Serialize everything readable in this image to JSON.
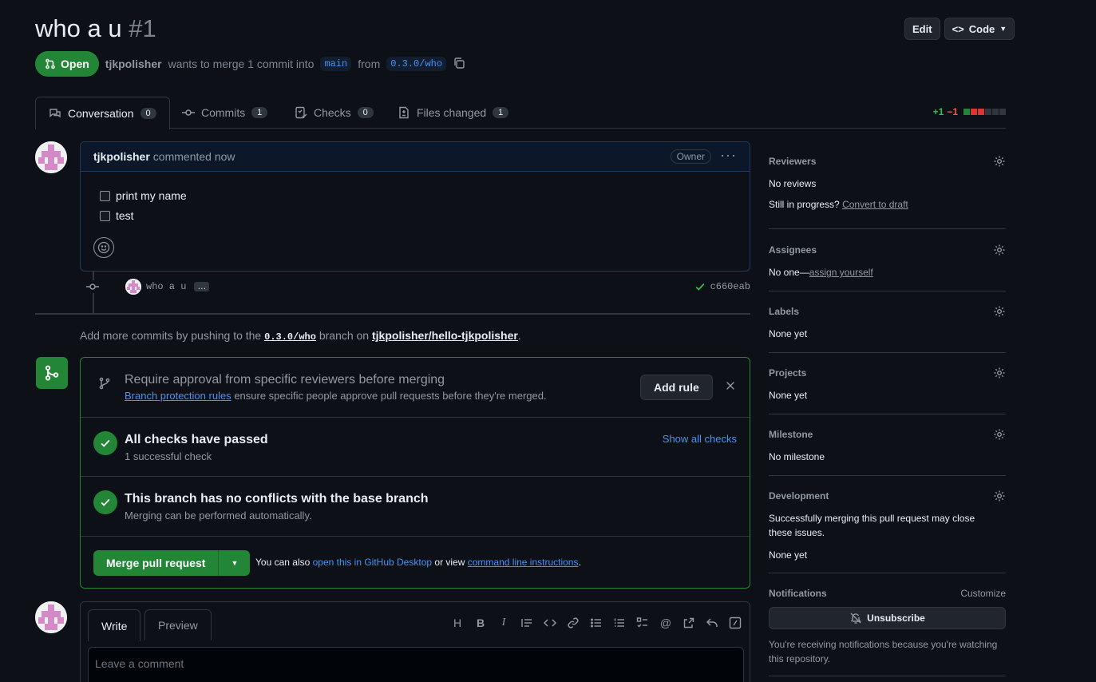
{
  "header": {
    "title": "who a u",
    "number": "#1",
    "edit_label": "Edit",
    "code_label": "Code"
  },
  "subline": {
    "state": "Open",
    "author": "tjkpolisher",
    "text1": "wants to merge 1 commit into",
    "base_branch": "main",
    "text2": "from",
    "head_branch": "0.3.0/who"
  },
  "tabs": [
    {
      "label": "Conversation",
      "count": "0"
    },
    {
      "label": "Commits",
      "count": "1"
    },
    {
      "label": "Checks",
      "count": "0"
    },
    {
      "label": "Files changed",
      "count": "1"
    }
  ],
  "diffstat": {
    "additions": "+1",
    "deletions": "−1"
  },
  "comment": {
    "author": "tjkpolisher",
    "time": "commented now",
    "badge": "Owner",
    "tasks": [
      "print my name",
      "test"
    ]
  },
  "commit": {
    "message": "who a u",
    "sha": "c660eab"
  },
  "push_note": {
    "prefix": "Add more commits by pushing to the",
    "branch": "0.3.0/who",
    "middle": "branch on",
    "repo": "tjkpolisher/hello-tjkpolisher",
    "suffix": "."
  },
  "mergebox": {
    "rule_title": "Require approval from specific reviewers before merging",
    "rule_link": "Branch protection rules",
    "rule_desc": "ensure specific people approve pull requests before they're merged.",
    "add_rule": "Add rule",
    "checks_title": "All checks have passed",
    "checks_sub": "1 successful check",
    "show_checks": "Show all checks",
    "conflict_title": "This branch has no conflicts with the base branch",
    "conflict_sub": "Merging can be performed automatically.",
    "merge_label": "Merge pull request",
    "also_text": "You can also",
    "desktop_link": "open this in GitHub Desktop",
    "or_text": "or view",
    "cli_link": "command line instructions",
    "end": "."
  },
  "form": {
    "write": "Write",
    "preview": "Preview",
    "placeholder": "Leave a comment"
  },
  "sidebar": {
    "reviewers": {
      "title": "Reviewers",
      "value": "No reviews",
      "progress_q": "Still in progress?",
      "draft_link": "Convert to draft"
    },
    "assignees": {
      "title": "Assignees",
      "value": "No one—",
      "link": "assign yourself"
    },
    "labels": {
      "title": "Labels",
      "value": "None yet"
    },
    "projects": {
      "title": "Projects",
      "value": "None yet"
    },
    "milestone": {
      "title": "Milestone",
      "value": "No milestone"
    },
    "development": {
      "title": "Development",
      "desc": "Successfully merging this pull request may close these issues.",
      "value": "None yet"
    },
    "notifications": {
      "title": "Notifications",
      "customize": "Customize",
      "button": "Unsubscribe",
      "note": "You're receiving notifications because you're watching this repository."
    }
  },
  "colors": {
    "accent_green": "#238636",
    "link_blue": "#4493f8",
    "bg": "#0d1117"
  }
}
